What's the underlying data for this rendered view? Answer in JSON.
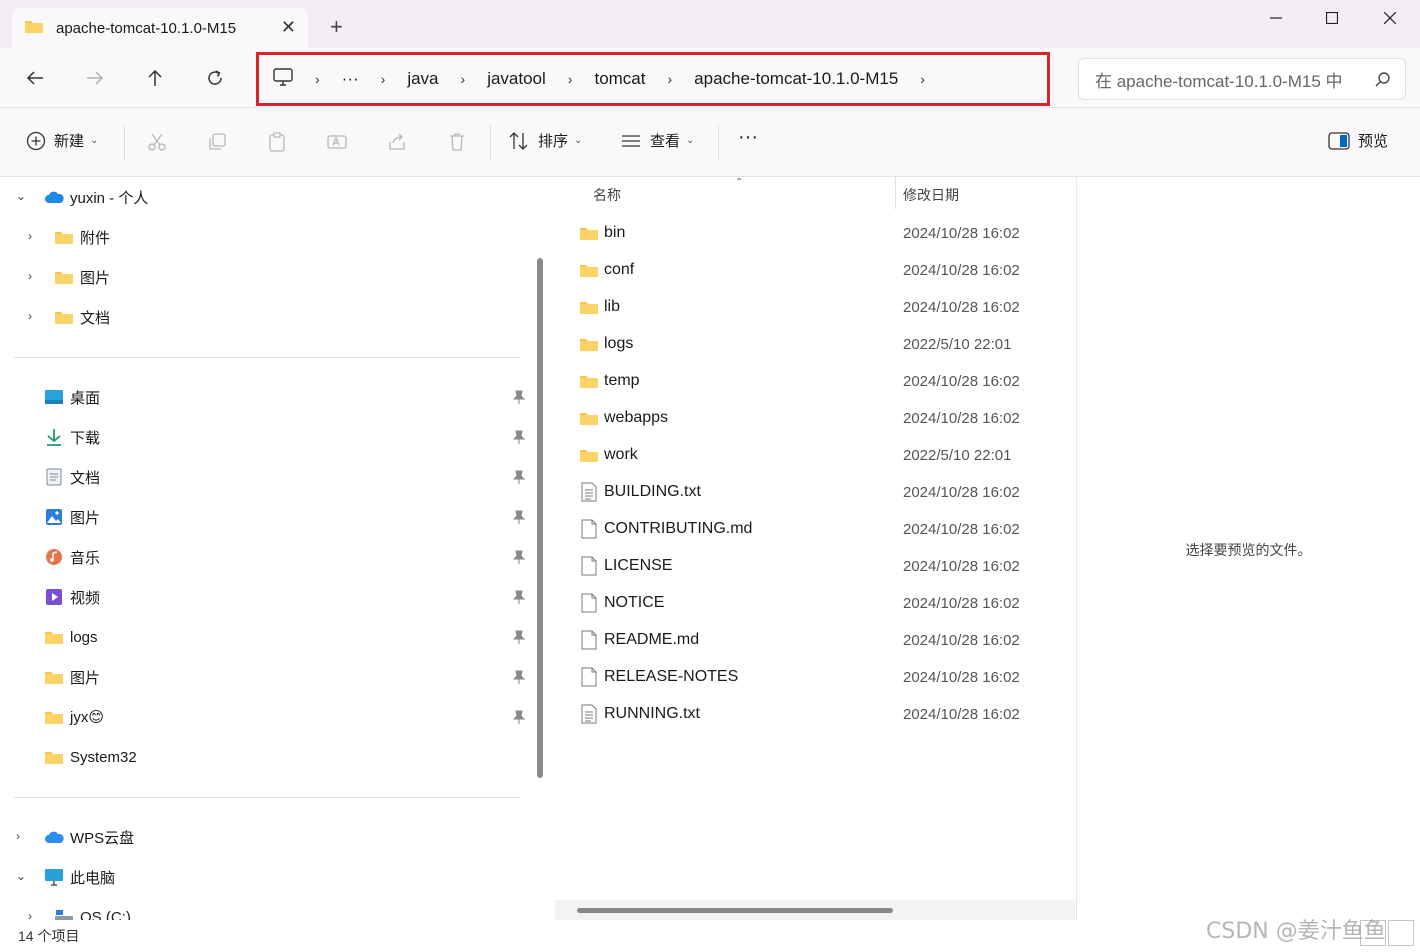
{
  "window": {
    "tab_title": "apache-tomcat-10.1.0-M15",
    "tab_close": "✕",
    "new_tab": "+"
  },
  "nav": {
    "breadcrumb": [
      "java",
      "javatool",
      "tomcat",
      "apache-tomcat-10.1.0-M15"
    ],
    "overflow": "···",
    "search_placeholder": "在 apache-tomcat-10.1.0-M15 中"
  },
  "toolbar": {
    "new_label": "新建",
    "sort_label": "排序",
    "view_label": "查看",
    "more_label": "···",
    "preview_label": "预览"
  },
  "sidebar": {
    "onedrive": "yuxin - 个人",
    "onedrive_children": [
      "附件",
      "图片",
      "文档"
    ],
    "quick_access": [
      {
        "label": "桌面",
        "icon": "desktop-icon"
      },
      {
        "label": "下载",
        "icon": "download-icon"
      },
      {
        "label": "文档",
        "icon": "document-icon"
      },
      {
        "label": "图片",
        "icon": "pictures-icon"
      },
      {
        "label": "音乐",
        "icon": "music-icon"
      },
      {
        "label": "视频",
        "icon": "video-icon"
      },
      {
        "label": "logs",
        "icon": "folder-icon"
      },
      {
        "label": "图片",
        "icon": "folder-icon"
      },
      {
        "label": "jyx😊",
        "icon": "folder-icon"
      },
      {
        "label": "System32",
        "icon": "folder-icon"
      }
    ],
    "wps": "WPS云盘",
    "this_pc": "此电脑",
    "os_drive": "OS (C:)"
  },
  "filelist": {
    "columns": {
      "name": "名称",
      "modified": "修改日期"
    },
    "files": [
      {
        "name": "bin",
        "date": "2024/10/28 16:02",
        "type": "folder"
      },
      {
        "name": "conf",
        "date": "2024/10/28 16:02",
        "type": "folder"
      },
      {
        "name": "lib",
        "date": "2024/10/28 16:02",
        "type": "folder"
      },
      {
        "name": "logs",
        "date": "2022/5/10 22:01",
        "type": "folder"
      },
      {
        "name": "temp",
        "date": "2024/10/28 16:02",
        "type": "folder"
      },
      {
        "name": "webapps",
        "date": "2024/10/28 16:02",
        "type": "folder"
      },
      {
        "name": "work",
        "date": "2022/5/10 22:01",
        "type": "folder"
      },
      {
        "name": "BUILDING.txt",
        "date": "2024/10/28 16:02",
        "type": "text"
      },
      {
        "name": "CONTRIBUTING.md",
        "date": "2024/10/28 16:02",
        "type": "file"
      },
      {
        "name": "LICENSE",
        "date": "2024/10/28 16:02",
        "type": "file"
      },
      {
        "name": "NOTICE",
        "date": "2024/10/28 16:02",
        "type": "file"
      },
      {
        "name": "README.md",
        "date": "2024/10/28 16:02",
        "type": "file"
      },
      {
        "name": "RELEASE-NOTES",
        "date": "2024/10/28 16:02",
        "type": "file"
      },
      {
        "name": "RUNNING.txt",
        "date": "2024/10/28 16:02",
        "type": "text"
      }
    ]
  },
  "preview": {
    "empty_message": "选择要预览的文件。"
  },
  "status": {
    "item_count": "14 个项目",
    "watermark": "CSDN @姜汁鱼鱼"
  },
  "colors": {
    "highlight_border": "#d9242b",
    "folder_yellow": "#f7c54a",
    "onedrive_blue": "#1e88e5"
  }
}
